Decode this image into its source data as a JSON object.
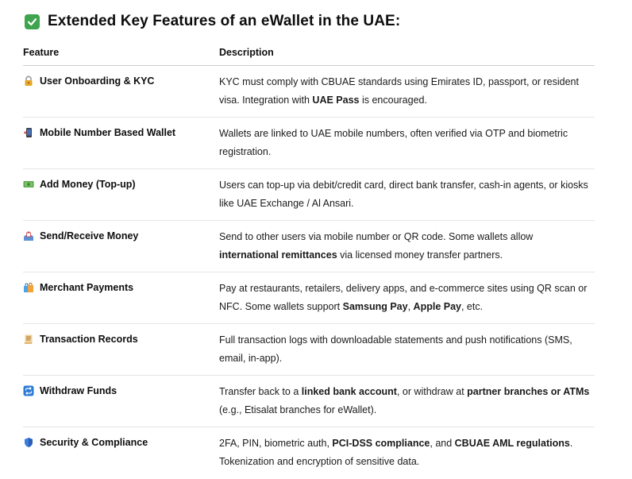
{
  "heading": "Extended Key Features of an eWallet in the UAE:",
  "table": {
    "headers": [
      "Feature",
      "Description"
    ],
    "rows": [
      {
        "icon": "lock-icon",
        "feature": "User Onboarding & KYC",
        "desc": [
          {
            "t": "KYC must comply with CBUAE standards using Emirates ID, passport, or resident visa. Integration with ",
            "b": false
          },
          {
            "t": "UAE Pass",
            "b": true
          },
          {
            "t": " is encouraged.",
            "b": false
          }
        ]
      },
      {
        "icon": "mobile-phone-icon",
        "feature": "Mobile Number Based Wallet",
        "desc": [
          {
            "t": "Wallets are linked to UAE mobile numbers, often verified via OTP and biometric registration.",
            "b": false
          }
        ]
      },
      {
        "icon": "money-icon",
        "feature": "Add Money (Top-up)",
        "desc": [
          {
            "t": "Users can top-up via debit/credit card, direct bank transfer, cash-in agents, or kiosks like UAE Exchange / Al Ansari.",
            "b": false
          }
        ]
      },
      {
        "icon": "outbox-tray-icon",
        "feature": "Send/Receive Money",
        "desc": [
          {
            "t": "Send to other users via mobile number or QR code. Some wallets allow ",
            "b": false
          },
          {
            "t": "international remittances",
            "b": true
          },
          {
            "t": " via licensed money transfer partners.",
            "b": false
          }
        ]
      },
      {
        "icon": "shopping-bags-icon",
        "feature": "Merchant Payments",
        "desc": [
          {
            "t": "Pay at restaurants, retailers, delivery apps, and e-commerce sites using QR scan or NFC. Some wallets support ",
            "b": false
          },
          {
            "t": "Samsung Pay",
            "b": true
          },
          {
            "t": ", ",
            "b": false
          },
          {
            "t": "Apple Pay",
            "b": true
          },
          {
            "t": ", etc.",
            "b": false
          }
        ]
      },
      {
        "icon": "scroll-icon",
        "feature": "Transaction Records",
        "desc": [
          {
            "t": "Full transaction logs with downloadable statements and push notifications (SMS, email, in-app).",
            "b": false
          }
        ]
      },
      {
        "icon": "repeat-arrows-icon",
        "feature": "Withdraw Funds",
        "desc": [
          {
            "t": "Transfer back to a ",
            "b": false
          },
          {
            "t": "linked bank account",
            "b": true
          },
          {
            "t": ", or withdraw at ",
            "b": false
          },
          {
            "t": "partner branches or ATMs",
            "b": true
          },
          {
            "t": " (e.g., Etisalat branches for eWallet).",
            "b": false
          }
        ]
      },
      {
        "icon": "shield-icon",
        "feature": "Security & Compliance",
        "desc": [
          {
            "t": "2FA, PIN, biometric auth, ",
            "b": false
          },
          {
            "t": "PCI-DSS compliance",
            "b": true
          },
          {
            "t": ", and ",
            "b": false
          },
          {
            "t": "CBUAE AML regulations",
            "b": true
          },
          {
            "t": ". Tokenization and encryption of sensitive data.",
            "b": false
          }
        ]
      }
    ]
  },
  "colors": {
    "check_green": "#3ea44e",
    "lock_gold": "#e7a52a",
    "phone_blue": "#4a6fb5",
    "money_green": "#5aa64a",
    "tray_blue": "#5b8fd6",
    "bag_blue": "#4ea2e8",
    "scroll_tan": "#e3b776",
    "repeat_blue": "#2e7bd6",
    "shield_blue": "#3b7de0"
  }
}
